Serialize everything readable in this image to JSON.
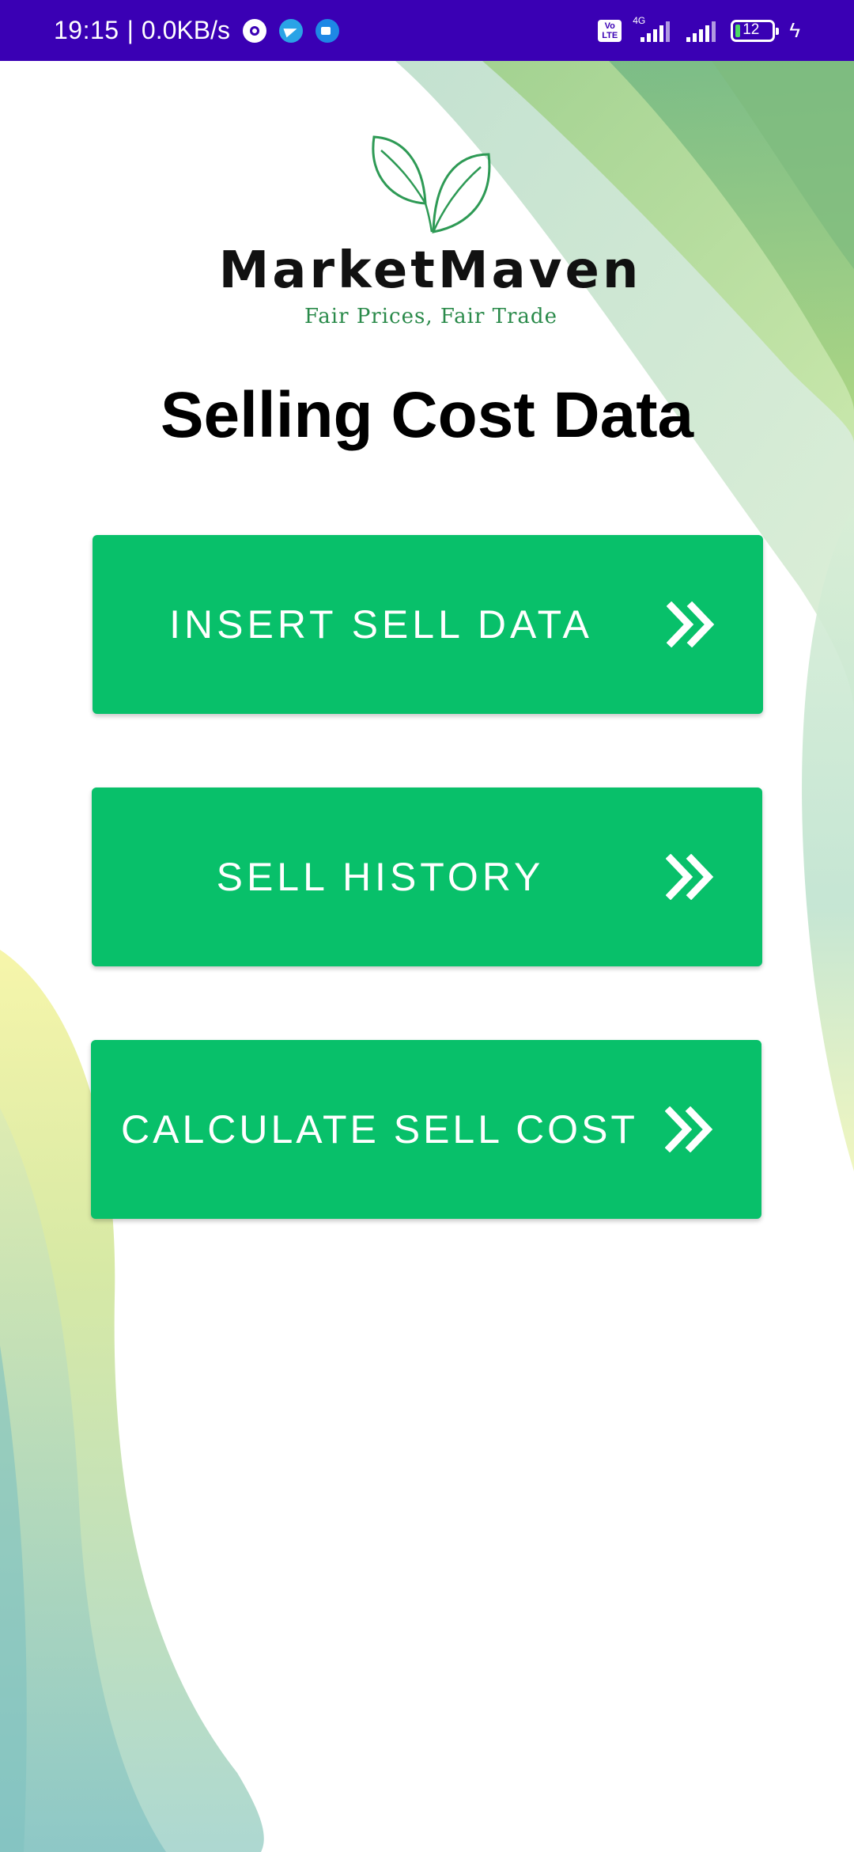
{
  "status_bar": {
    "time": "19:15",
    "separator": "|",
    "network_speed": "0.0KB/s",
    "network_type": "4G",
    "volte": "Vo LTE",
    "battery_percent": "12",
    "notification_icons": [
      "settings-icon",
      "telegram-icon",
      "meet-icon"
    ]
  },
  "brand": {
    "name": "MarketMaven",
    "tagline": "Fair Prices, Fair Trade"
  },
  "page": {
    "title": "Selling Cost Data"
  },
  "buttons": [
    {
      "label": "INSERT SELL DATA",
      "icon": "double-chevron-right-icon"
    },
    {
      "label": "SELL HISTORY",
      "icon": "double-chevron-right-icon"
    },
    {
      "label": "CALCULATE SELL COST",
      "icon": "double-chevron-right-icon"
    }
  ],
  "colors": {
    "status_bar": "#3a00b4",
    "button": "#08c06a",
    "brand_green": "#2a8a4a"
  }
}
